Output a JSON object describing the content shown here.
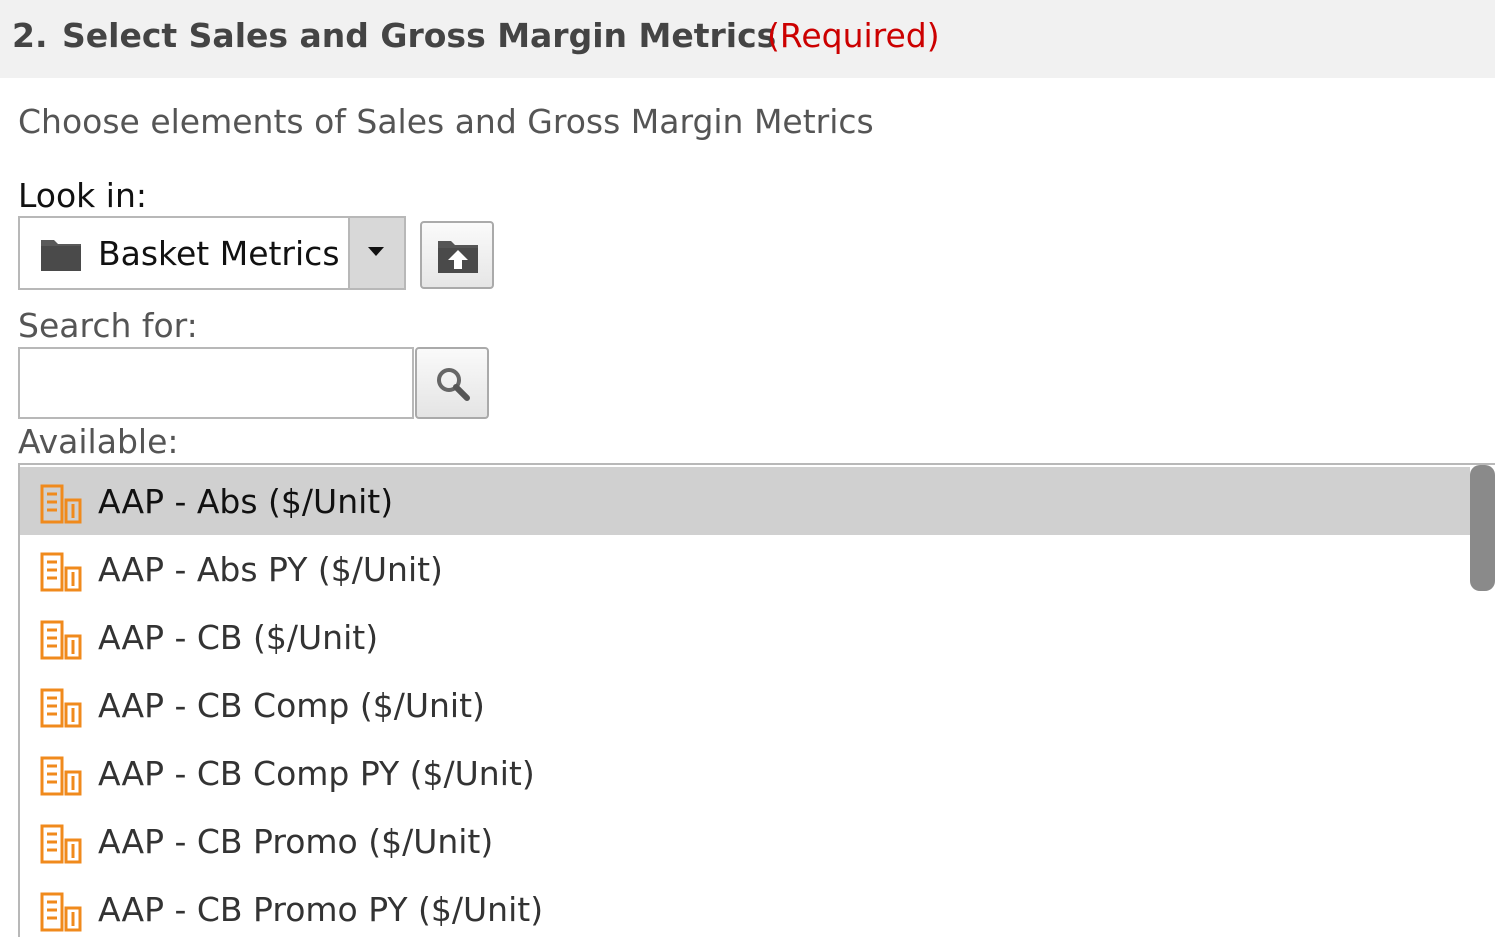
{
  "section": {
    "step_number": "2.",
    "title": "Select Sales and Gross Margin Metrics",
    "required_label": "(Required)",
    "instructions": "Choose elements of Sales and Gross Margin Metrics"
  },
  "look_in": {
    "label": "Look in:",
    "value": "Basket Metrics",
    "folder_icon": "folder-icon",
    "dropdown_icon": "chevron-down-icon",
    "up_button_icon": "folder-up-icon"
  },
  "search": {
    "label": "Search for:",
    "value": "",
    "button_icon": "search-icon"
  },
  "available": {
    "label": "Available:",
    "item_icon": "metric-icon",
    "items": [
      {
        "label": "AAP - Abs ($/Unit)",
        "selected": true
      },
      {
        "label": "AAP - Abs PY ($/Unit)",
        "selected": false
      },
      {
        "label": "AAP - CB ($/Unit)",
        "selected": false
      },
      {
        "label": "AAP - CB Comp ($/Unit)",
        "selected": false
      },
      {
        "label": "AAP - CB Comp PY ($/Unit)",
        "selected": false
      },
      {
        "label": "AAP - CB Promo ($/Unit)",
        "selected": false
      },
      {
        "label": "AAP - CB Promo PY ($/Unit)",
        "selected": false
      }
    ]
  },
  "colors": {
    "required": "#cc0000",
    "header_bg": "#f1f1f1",
    "selected_row": "#d0d0d0",
    "metric_icon": "#f08a1c"
  }
}
